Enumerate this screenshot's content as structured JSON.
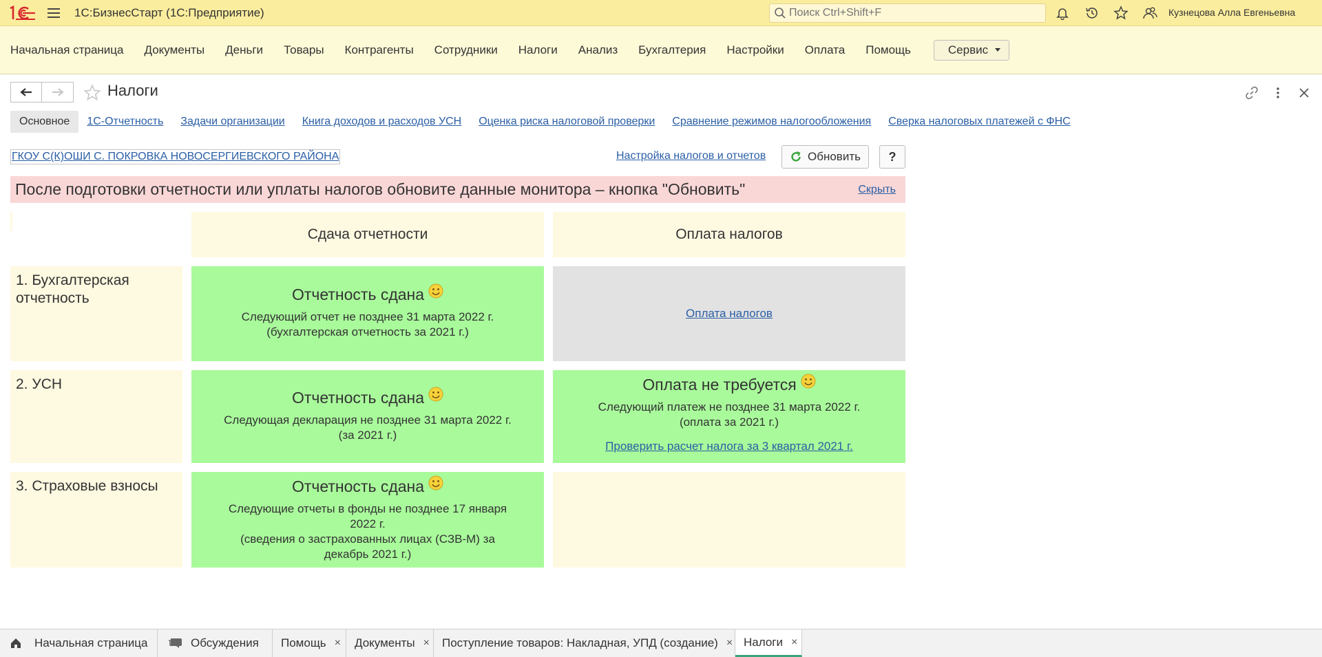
{
  "titlebar": {
    "app_title": "1С:БизнесСтарт  (1С:Предприятие)",
    "search_placeholder": "Поиск Ctrl+Shift+F",
    "user_name": "Кузнецова Алла Евгеньевна",
    "icons": [
      "logo-1c-icon",
      "menu-icon",
      "search-icon",
      "bell-icon",
      "history-icon",
      "star-icon",
      "users-icon"
    ]
  },
  "menu": {
    "items": [
      "Начальная страница",
      "Документы",
      "Деньги",
      "Товары",
      "Контрагенты",
      "Сотрудники",
      "Налоги",
      "Анализ",
      "Бухгалтерия",
      "Настройки",
      "Оплата",
      "Помощь"
    ],
    "service_label": "Сервис"
  },
  "form": {
    "title": "Налоги",
    "tabs": [
      "Основное",
      "1С-Отчетность",
      "Задачи организации",
      "Книга доходов и расходов УСН",
      "Оценка риска налоговой проверки",
      "Сравнение режимов налогообложения",
      "Сверка налоговых платежей с ФНС"
    ],
    "organization": "ГКОУ С(К)ОШИ С. ПОКРОВКА НОВОСЕРГИЕВСКОГО РАЙОНА",
    "settings_link": "Настройка налогов и отчетов",
    "refresh_label": "Обновить",
    "help_label": "?",
    "banner_text": "После подготовки отчетности или уплаты налогов обновите данные монитора – кнопка \"Обновить\"",
    "banner_hide": "Скрыть"
  },
  "grid": {
    "col_reports": "Сдача отчетности",
    "col_payments": "Оплата налогов",
    "rows": [
      {
        "label": "1. Бухгалтерская отчетность",
        "report_title": "Отчетность сдана",
        "report_line1": "Следующий отчет не позднее 31 марта 2022 г.",
        "report_line2": "(бухгалтерская отчетность за 2021 г.)",
        "payment_link": "Оплата налогов"
      },
      {
        "label": "2. УСН",
        "report_title": "Отчетность сдана",
        "report_line1": "Следующая декларация не позднее 31 марта 2022 г.",
        "report_line2": "(за 2021 г.)",
        "payment_title": "Оплата не требуется",
        "payment_line1": "Следующий платеж не позднее 31 марта 2022 г.",
        "payment_line2": "(оплата за 2021 г.)",
        "payment_link": "Проверить расчет налога за 3 квартал 2021 г."
      },
      {
        "label": "3. Страховые взносы",
        "report_title": "Отчетность сдана",
        "report_line1": "Следующие отчеты в фонды не позднее 17 января",
        "report_line2": "2022 г.",
        "report_line3": "(сведения о застрахованных лицах (СЗВ-М) за",
        "report_line4": "декабрь 2021 г.)"
      }
    ]
  },
  "taskbar": {
    "items": [
      "Начальная страница",
      "Обсуждения",
      "Помощь",
      "Документы",
      "Поступление товаров: Накладная, УПД (создание)",
      "Налоги"
    ],
    "close_glyph": "×"
  },
  "colors": {
    "titlebar": "#fbed9e",
    "menubar": "#fdfad7",
    "green_cell": "#a9fa9b",
    "cream_cell": "#fef9e1",
    "gray_cell": "#e2e2e2",
    "banner": "#fad7d7",
    "link": "#2a5ea5"
  }
}
